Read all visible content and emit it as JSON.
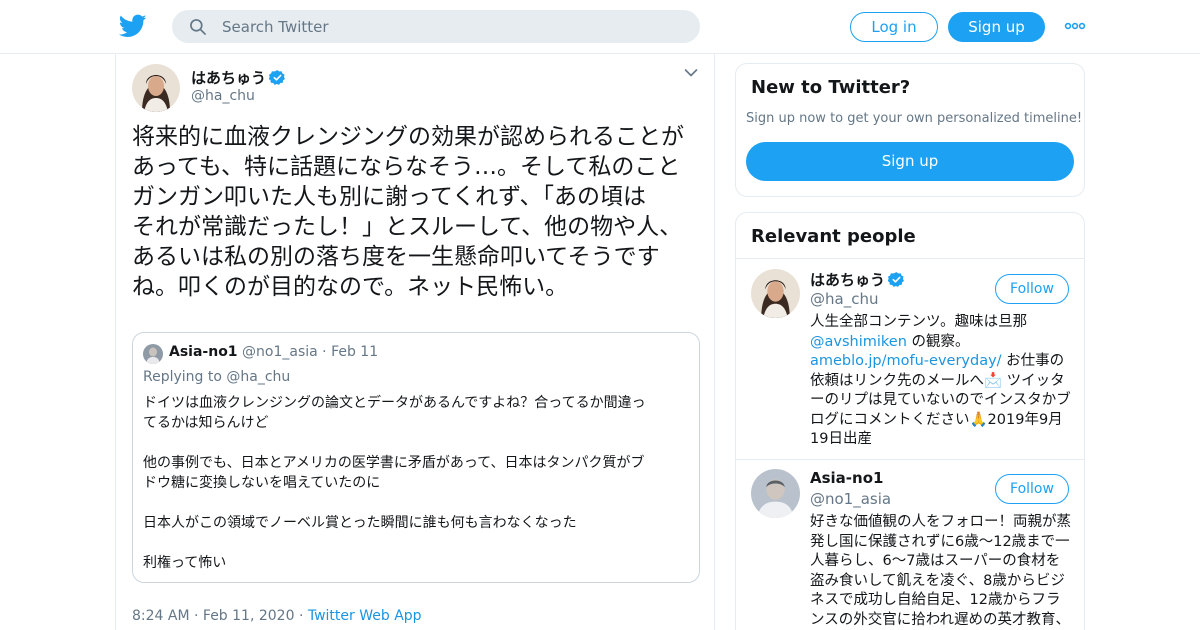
{
  "header": {
    "logo_icon": "twitter-bird-icon",
    "search_placeholder": "Search Twitter",
    "login_label": "Log in",
    "signup_label": "Sign up",
    "more_icon": "more-dots-icon",
    "accent_color": "#1da1f2"
  },
  "tweet": {
    "author_name": "はあちゅう",
    "author_handle": "@ha_chu",
    "verified": true,
    "text": "将来的に血液クレンジングの効果が認められることが\nあっても、特に話題にならなそう…。そして私のこと\nガンガン叩いた人も別に謝ってくれず、「あの頃は\nそれが常識だったし！」とスルーして、他の物や人、\nあるいは私の別の落ち度を一生懸命叩いてそうです\nね。叩くのが目的なので。ネット民怖い。",
    "quote": {
      "name": "Asia-no1",
      "handle": "@no1_asia",
      "separator": "·",
      "date": "Feb 11",
      "replying_prefix": "Replying to",
      "replying_to": "@ha_chu",
      "body": "ドイツは血液クレンジングの論文とデータがあるんですよね？合ってるか間違っ\nてるかは知らんけど\n\n他の事例でも、日本とアメリカの医学書に矛盾があって、日本はタンパク質がブ\nドウ糖に変換しないを唱えていたのに\n\n日本人がこの領域でノーベル賞とった瞬間に誰も何も言わなくなった\n\n利権って怖い"
    },
    "time": "8:24 AM",
    "separator": "·",
    "date": "Feb 11, 2020",
    "source": "Twitter Web App"
  },
  "sidebar": {
    "new_title": "New to Twitter?",
    "new_subtitle": "Sign up now to get your own personalized timeline!",
    "new_signup": "Sign up",
    "relevant_title": "Relevant people",
    "people": [
      {
        "name": "はあちゅう",
        "handle": "@ha_chu",
        "verified": true,
        "follow": "Follow",
        "bio_1": "人生全部コンテンツ。趣味は旦那",
        "bio_link_1": "@avshimiken",
        "bio_2": " の観察。",
        "bio_link_2": "ameblo.jp/mofu-everyday/",
        "bio_3": " お仕事の依頼はリンク先のメールへ📩 ツイッターのリプは見ていないのでインスタかブログにコメントください🙏2019年9月19日出産"
      },
      {
        "name": "Asia-no1",
        "handle": "@no1_asia",
        "verified": false,
        "follow": "Follow",
        "bio": "好きな価値観の人をフォロー！両親が蒸発し国に保護されずに6歳〜12歳まで一人暮らし、6〜7歳はスーパーの食材を盗み食いして飢えを凌ぐ、8歳からビジネスで成功し自給自足、12歳からフランスの外交官に拾われ遅めの英才教育、投資もしつつ今は日本在住"
      }
    ]
  }
}
